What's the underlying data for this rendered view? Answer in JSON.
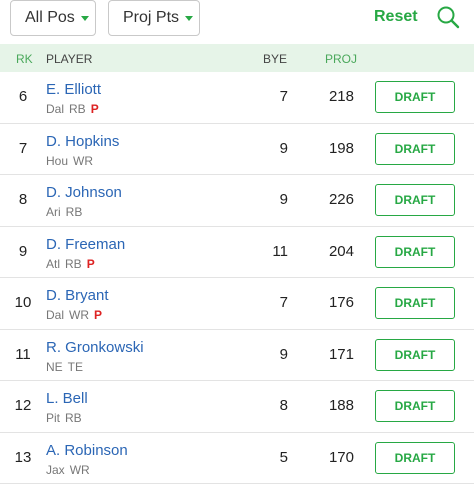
{
  "filters": {
    "position": "All Pos",
    "sort": "Proj Pts",
    "reset_label": "Reset",
    "accent_color": "#27a844"
  },
  "table": {
    "headers": {
      "rank": "RK",
      "player": "PLAYER",
      "bye": "BYE",
      "proj": "PROJ"
    },
    "draft_label": "DRAFT",
    "rows": [
      {
        "rank": "6",
        "name": "E. Elliott",
        "team": "Dal",
        "pos": "RB",
        "flag": "P",
        "bye": "7",
        "proj": "218"
      },
      {
        "rank": "7",
        "name": "D. Hopkins",
        "team": "Hou",
        "pos": "WR",
        "flag": "",
        "bye": "9",
        "proj": "198"
      },
      {
        "rank": "8",
        "name": "D. Johnson",
        "team": "Ari",
        "pos": "RB",
        "flag": "",
        "bye": "9",
        "proj": "226"
      },
      {
        "rank": "9",
        "name": "D. Freeman",
        "team": "Atl",
        "pos": "RB",
        "flag": "P",
        "bye": "11",
        "proj": "204"
      },
      {
        "rank": "10",
        "name": "D. Bryant",
        "team": "Dal",
        "pos": "WR",
        "flag": "P",
        "bye": "7",
        "proj": "176"
      },
      {
        "rank": "11",
        "name": "R. Gronkowski",
        "team": "NE",
        "pos": "TE",
        "flag": "",
        "bye": "9",
        "proj": "171"
      },
      {
        "rank": "12",
        "name": "L. Bell",
        "team": "Pit",
        "pos": "RB",
        "flag": "",
        "bye": "8",
        "proj": "188"
      },
      {
        "rank": "13",
        "name": "A. Robinson",
        "team": "Jax",
        "pos": "WR",
        "flag": "",
        "bye": "5",
        "proj": "170"
      }
    ]
  }
}
